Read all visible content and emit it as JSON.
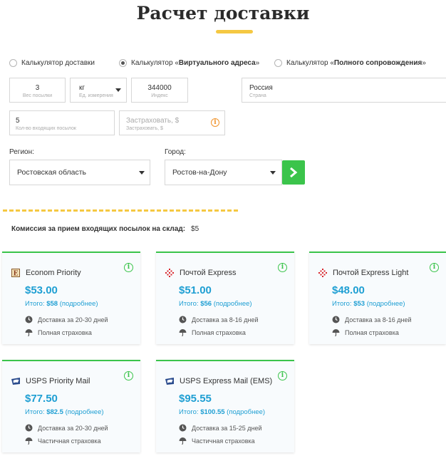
{
  "page": {
    "title": "Расчет доставки"
  },
  "calculator_tabs": [
    {
      "label_plain": "Калькулятор доставки",
      "label_bold": "",
      "checked": false
    },
    {
      "label_plain": "Калькулятор «",
      "label_bold": "Виртуального адреса",
      "label_end": "»",
      "checked": true
    },
    {
      "label_plain": "Калькулятор «",
      "label_bold": "Полного сопровождения",
      "label_end": "»",
      "checked": false
    }
  ],
  "fields": {
    "weight": {
      "value": "3",
      "label": "Вес посылки"
    },
    "unit": {
      "value": "кг",
      "label": "Ед. измерения"
    },
    "index": {
      "value": "344000",
      "label": "Индекс"
    },
    "country": {
      "value": "Россия",
      "label": "Страна"
    },
    "parcels": {
      "value": "5",
      "label": "Кол-во входящих посылок"
    },
    "insure": {
      "placeholder": "Застраховать, $",
      "label": "Застраховать, $"
    }
  },
  "region": {
    "label": "Регион:",
    "value": "Ростовская область"
  },
  "city": {
    "label": "Город:",
    "value": "Ростов-на-Дону"
  },
  "commission": {
    "label": "Комиссия за прием входящих посылок на склад:",
    "amount": "$5"
  },
  "total_prefix": "Итого:",
  "details_label": "(подробнее)",
  "options": [
    {
      "name": "Econom Priority",
      "price": "$53.00",
      "total": "$58",
      "delivery": "Доставка за 20-30 дней",
      "insurance": "Полная страховка",
      "logo": "econom-logo-icon"
    },
    {
      "name": "Почтой Express",
      "price": "$51.00",
      "total": "$56",
      "delivery": "Доставка за 8-16 дней",
      "insurance": "Полная страховка",
      "logo": "pochta-logo-icon"
    },
    {
      "name": "Почтой Express Light",
      "price": "$48.00",
      "total": "$53",
      "delivery": "Доставка за 8-16 дней",
      "insurance": "Полная страховка",
      "logo": "pochta-logo-icon"
    },
    {
      "name": "USPS Priority Mail",
      "price": "$77.50",
      "total": "$82.5",
      "delivery": "Доставка за 20-30 дней",
      "insurance": "Частичная страховка",
      "logo": "usps-logo-icon"
    },
    {
      "name": "USPS Express Mail (EMS)",
      "price": "$95.55",
      "total": "$100.55",
      "delivery": "Доставка за 15-25 дней",
      "insurance": "Частичная страховка",
      "logo": "usps-logo-icon"
    }
  ],
  "colors": {
    "accent_green": "#3bc44b",
    "price_blue": "#1f9fd3",
    "highlight_yellow": "#f5c842",
    "warning_orange": "#f0932b"
  }
}
